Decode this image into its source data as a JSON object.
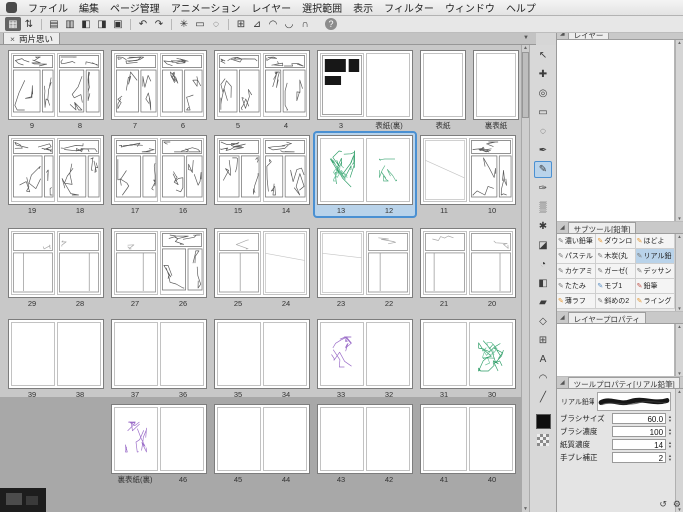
{
  "colors": {
    "accent": "#4a90d2",
    "selection_bg": "#b9d3ea",
    "canvas": "#c8c8c8",
    "canvas_outside": "#a8a8a8",
    "green_sketch": "#2f9e68",
    "purple_sketch": "#9a6cc8"
  },
  "menu_bar": {
    "items": [
      "ファイル",
      "編集",
      "ページ管理",
      "アニメーション",
      "レイヤー",
      "選択範囲",
      "表示",
      "フィルター",
      "ウィンドウ",
      "ヘルプ"
    ]
  },
  "toolbar": {
    "help_glyph": "?",
    "icons": [
      {
        "name": "page-manager-view-button",
        "glyph": "▦",
        "active": true
      },
      {
        "name": "page-spinner",
        "glyph": "⇅"
      },
      {
        "name": "sep1"
      },
      {
        "name": "new-page-button",
        "glyph": "▤"
      },
      {
        "name": "add-page-button",
        "glyph": "▥"
      },
      {
        "name": "flip-left-button",
        "glyph": "◧"
      },
      {
        "name": "flip-right-button",
        "glyph": "◨"
      },
      {
        "name": "save-button",
        "glyph": "▣"
      },
      {
        "name": "sep2"
      },
      {
        "name": "undo-button",
        "glyph": "↶"
      },
      {
        "name": "redo-button",
        "glyph": "↷"
      },
      {
        "name": "sep3"
      },
      {
        "name": "transform-button",
        "glyph": "✳"
      },
      {
        "name": "select-rect-button",
        "glyph": "▭"
      },
      {
        "name": "deselect-button",
        "glyph": "◌"
      },
      {
        "name": "sep4"
      },
      {
        "name": "grid-button",
        "glyph": "⊞"
      },
      {
        "name": "ruler-button",
        "glyph": "⊿"
      },
      {
        "name": "snap-ruler-button",
        "glyph": "◠"
      },
      {
        "name": "snap-grid-button",
        "glyph": "◡"
      },
      {
        "name": "snap-special-button",
        "glyph": "∩"
      }
    ]
  },
  "tab_bar": {
    "close_glyph": "×",
    "title": "両片思い",
    "list_dropdown_glyph": "▼"
  },
  "scrollbar": {
    "up_glyph": "▲",
    "down_glyph": "▼"
  },
  "page_manager": {
    "rows": [
      {
        "cells": [
          {
            "type": "spread",
            "pages": [
              {
                "label": "9",
                "art": "dense"
              },
              {
                "label": "8",
                "art": "dense"
              }
            ]
          },
          {
            "type": "spread",
            "pages": [
              {
                "label": "7",
                "art": "dense"
              },
              {
                "label": "6",
                "art": "dense"
              }
            ]
          },
          {
            "type": "spread",
            "pages": [
              {
                "label": "5",
                "art": "dense"
              },
              {
                "label": "4",
                "art": "dense"
              }
            ]
          },
          {
            "type": "spread",
            "pages": [
              {
                "label": "3",
                "art": "black"
              },
              {
                "label": "表紙(裏)",
                "art": "blank"
              }
            ]
          },
          {
            "type": "single",
            "pages": [
              {
                "label": "表紙",
                "art": "blank"
              }
            ]
          },
          {
            "type": "single",
            "pages": [
              {
                "label": "裏表紙",
                "art": "blank"
              }
            ]
          }
        ]
      },
      {
        "cells": [
          {
            "type": "spread",
            "pages": [
              {
                "label": "19",
                "art": "dense"
              },
              {
                "label": "18",
                "art": "dense"
              }
            ]
          },
          {
            "type": "spread",
            "pages": [
              {
                "label": "17",
                "art": "dense"
              },
              {
                "label": "16",
                "art": "dense"
              }
            ]
          },
          {
            "type": "spread",
            "pages": [
              {
                "label": "15",
                "art": "dense"
              },
              {
                "label": "14",
                "art": "dense"
              }
            ]
          },
          {
            "type": "spread",
            "selected": true,
            "pages": [
              {
                "label": "13",
                "art": "green"
              },
              {
                "label": "12",
                "art": "greenlight"
              }
            ]
          },
          {
            "type": "spread",
            "pages": [
              {
                "label": "11",
                "art": "light"
              },
              {
                "label": "10",
                "art": "dense"
              }
            ]
          }
        ]
      },
      {
        "cells": [
          {
            "type": "spread",
            "pages": [
              {
                "label": "29",
                "art": "panels"
              },
              {
                "label": "28",
                "art": "panels"
              }
            ]
          },
          {
            "type": "spread",
            "pages": [
              {
                "label": "27",
                "art": "panels"
              },
              {
                "label": "26",
                "art": "dense"
              }
            ]
          },
          {
            "type": "spread",
            "pages": [
              {
                "label": "25",
                "art": "panels"
              },
              {
                "label": "24",
                "art": "light"
              }
            ]
          },
          {
            "type": "spread",
            "pages": [
              {
                "label": "23",
                "art": "light"
              },
              {
                "label": "22",
                "art": "panels"
              }
            ]
          },
          {
            "type": "spread",
            "pages": [
              {
                "label": "21",
                "art": "panels"
              },
              {
                "label": "20",
                "art": "panels"
              }
            ]
          }
        ]
      },
      {
        "cells": [
          {
            "type": "spread",
            "pages": [
              {
                "label": "39",
                "art": "blank"
              },
              {
                "label": "38",
                "art": "blank"
              }
            ]
          },
          {
            "type": "spread",
            "pages": [
              {
                "label": "37",
                "art": "blank"
              },
              {
                "label": "36",
                "art": "blank"
              }
            ]
          },
          {
            "type": "spread",
            "pages": [
              {
                "label": "35",
                "art": "blank"
              },
              {
                "label": "34",
                "art": "blank"
              }
            ]
          },
          {
            "type": "spread",
            "pages": [
              {
                "label": "33",
                "art": "purple"
              },
              {
                "label": "32",
                "art": "blank"
              }
            ]
          },
          {
            "type": "spread",
            "pages": [
              {
                "label": "31",
                "art": "blank"
              },
              {
                "label": "30",
                "art": "green"
              }
            ]
          }
        ]
      },
      {
        "offset_left": true,
        "cells": [
          {
            "type": "spread",
            "pages": [
              {
                "label": "裏表紙(裏)",
                "art": "purple"
              },
              {
                "label": "46",
                "art": "blank"
              }
            ]
          },
          {
            "type": "spread",
            "pages": [
              {
                "label": "45",
                "art": "blank"
              },
              {
                "label": "44",
                "art": "blank"
              }
            ]
          },
          {
            "type": "spread",
            "pages": [
              {
                "label": "43",
                "art": "blank"
              },
              {
                "label": "42",
                "art": "blank"
              }
            ]
          },
          {
            "type": "spread",
            "pages": [
              {
                "label": "41",
                "art": "blank"
              },
              {
                "label": "40",
                "art": "blank"
              }
            ]
          }
        ]
      }
    ]
  },
  "tool_strip": {
    "selected_index": 6,
    "tools": [
      {
        "name": "operation-tool",
        "glyph": "↖"
      },
      {
        "name": "move-tool",
        "glyph": "✚"
      },
      {
        "name": "zoom-tool",
        "glyph": "◎"
      },
      {
        "name": "marquee-select-tool",
        "glyph": "▭"
      },
      {
        "name": "lasso-select-tool",
        "glyph": "◌"
      },
      {
        "name": "pen-tool",
        "glyph": "✒"
      },
      {
        "name": "pencil-tool",
        "glyph": "✎"
      },
      {
        "name": "brush-tool",
        "glyph": "✑"
      },
      {
        "name": "airbrush-tool",
        "glyph": "▒"
      },
      {
        "name": "decoration-tool",
        "glyph": "✱"
      },
      {
        "name": "eraser-tool",
        "glyph": "◪"
      },
      {
        "name": "blend-tool",
        "glyph": "◔"
      },
      {
        "name": "fill-tool",
        "glyph": "◧"
      },
      {
        "name": "gradient-tool",
        "glyph": "▰"
      },
      {
        "name": "figure-tool",
        "glyph": "◇"
      },
      {
        "name": "frame-border-tool",
        "glyph": "⊞"
      },
      {
        "name": "text-tool",
        "glyph": "A"
      },
      {
        "name": "balloon-tool",
        "glyph": "◠"
      },
      {
        "name": "line-correction-tool",
        "glyph": "╱"
      }
    ]
  },
  "dock": {
    "left_icon": {
      "name": "show-all-panels-icon",
      "glyph": "»"
    },
    "right_icons": [
      {
        "name": "dock-layout-icon-1",
        "glyph": "◧"
      },
      {
        "name": "dock-layout-icon-2",
        "glyph": "◨"
      },
      {
        "name": "collapse-dock-icon",
        "glyph": "«"
      }
    ]
  },
  "panels": {
    "collapse_glyph": "◢",
    "layer": {
      "title": "レイヤー"
    },
    "subtool": {
      "title": "サブツール[鉛筆]",
      "items": [
        {
          "label": "濃い鉛筆"
        },
        {
          "label": "ダウンロ",
          "color": "#e49b3c"
        },
        {
          "label": "ほどよ",
          "color": "#e49b3c"
        },
        {
          "label": "パステル"
        },
        {
          "label": "木炭(丸"
        },
        {
          "label": "リアル鉛",
          "selected": true
        },
        {
          "label": "カケアミ"
        },
        {
          "label": "ガーゼ("
        },
        {
          "label": "デッサン"
        },
        {
          "label": "たたみ"
        },
        {
          "label": "モブ1",
          "color": "#5a8fc4"
        },
        {
          "label": "鉛筆",
          "color": "#c0574f"
        },
        {
          "label": "薄ラフ",
          "color": "#e49b3c"
        },
        {
          "label": "斜めの2"
        },
        {
          "label": "ライング",
          "color": "#e49b3c"
        }
      ]
    },
    "layer_property": {
      "title": "レイヤープロパティ"
    },
    "tool_property": {
      "title": "ツールプロパティ[リアル鉛筆]",
      "brush_name": "リアル鉛筆",
      "sliders": [
        {
          "label": "ブラシサイズ",
          "value": "60.0"
        },
        {
          "label": "ブラシ濃度",
          "value": "100"
        },
        {
          "label": "紙質濃度",
          "value": "14"
        },
        {
          "label": "手ブレ補正",
          "value": "2"
        }
      ],
      "footer_icons": [
        {
          "name": "reset-all-settings-icon",
          "glyph": "↺"
        },
        {
          "name": "subtool-detail-icon",
          "glyph": "⚙"
        }
      ]
    }
  }
}
